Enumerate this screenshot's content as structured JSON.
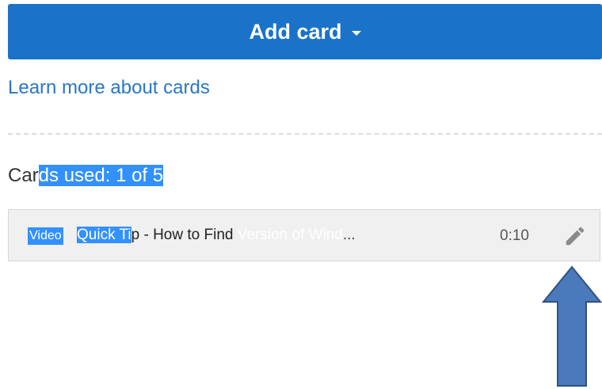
{
  "add_card_button": {
    "label": "Add card"
  },
  "learn_more_link": {
    "label": "Learn more about cards"
  },
  "cards_used": {
    "prefix": "Car",
    "highlighted": "ds used: 1 of 5"
  },
  "card": {
    "type": "Video",
    "title_highlighted": "Quick Ti",
    "title_mid": "p - How to Find ",
    "title_faded": "Version of Wind",
    "title_ellipsis": "...",
    "duration": "0:10"
  },
  "colors": {
    "button_bg": "#1a73c8",
    "link": "#2a76c6",
    "selection": "#3390ff",
    "arrow_fill": "#4a7abb",
    "arrow_stroke": "#2f5281"
  },
  "icons": {
    "caret": "caret-down-icon",
    "edit": "pencil-icon",
    "annotation": "arrow-up-icon"
  }
}
